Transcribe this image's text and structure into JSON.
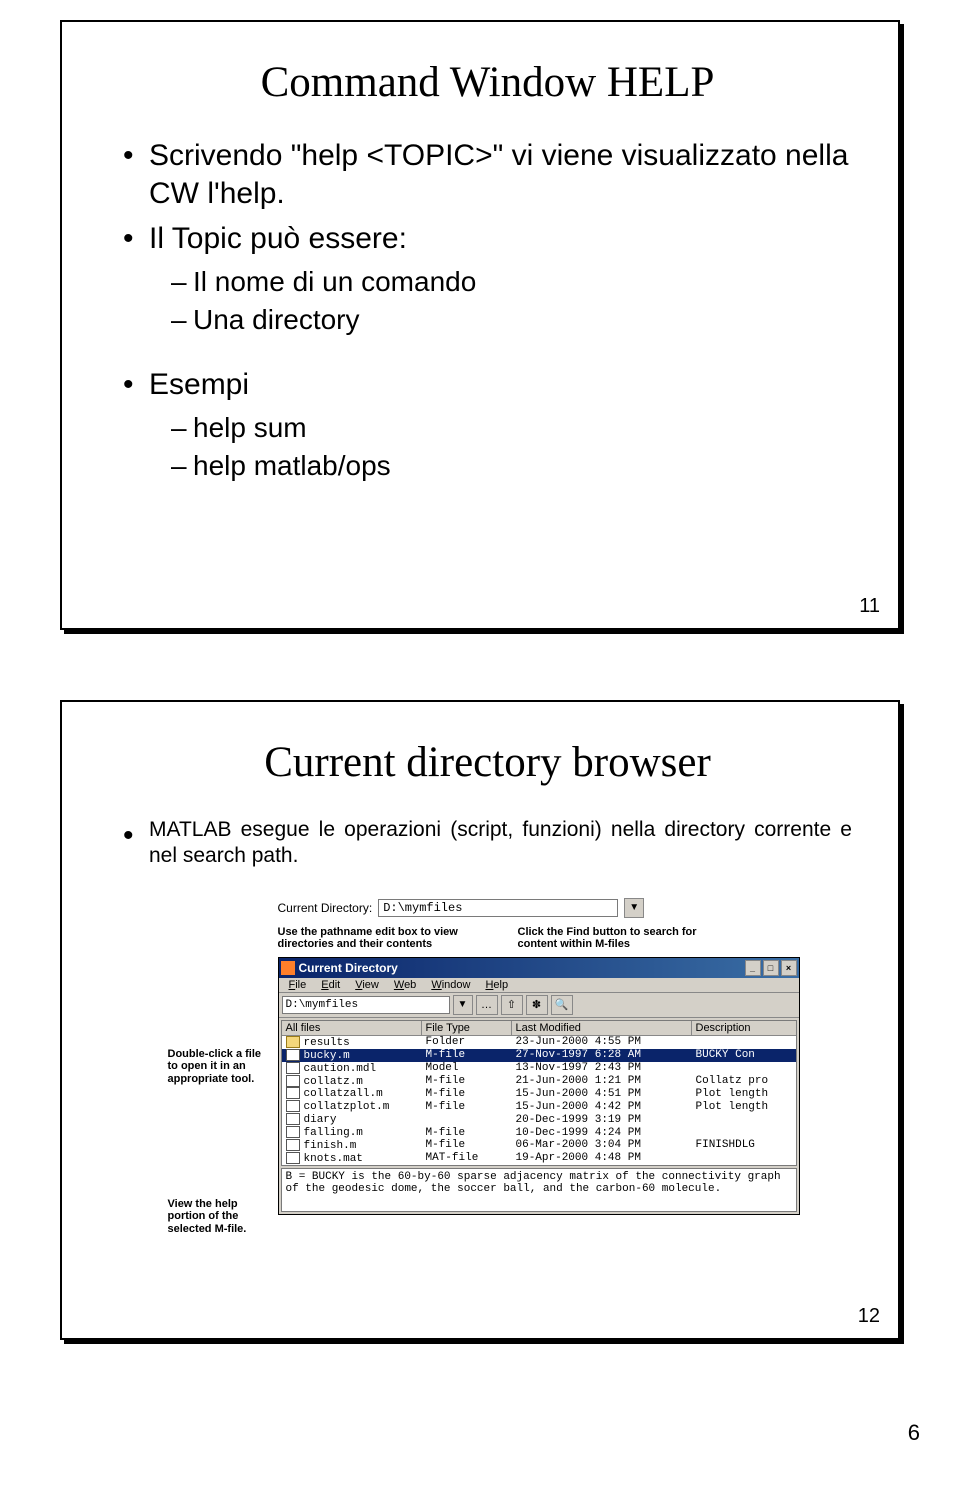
{
  "page_number": "6",
  "slide1": {
    "title": "Command Window HELP",
    "bullet1": "Scrivendo \"help <TOPIC>\" vi viene visualizzato nella CW l'help.",
    "bullet2": "Il Topic può essere:",
    "sub2a": "Il nome di un comando",
    "sub2b": "Una directory",
    "bullet3": "Esempi",
    "sub3a": "help sum",
    "sub3b": "help matlab/ops",
    "num": "11"
  },
  "slide2": {
    "title": "Current directory browser",
    "body": "MATLAB esegue le operazioni (script, funzioni) nella directory corrente e nel search path.",
    "num": "12",
    "cd_label": "Current Directory:",
    "cd_value": "D:\\mymfiles",
    "callout_left_top": "Use the pathname edit box to view directories and their contents",
    "callout_right_top": "Click the Find button to search for content within M-files",
    "callout_side1": "Double-click a file to open it in an appropriate tool.",
    "callout_side2": "View the help portion of the selected M-file.",
    "win_title": "Current Directory",
    "menus": [
      "File",
      "Edit",
      "View",
      "Web",
      "Window",
      "Help"
    ],
    "toolbar_path": "D:\\mymfiles",
    "headers": [
      "All files",
      "File Type",
      "Last Modified",
      "Description"
    ],
    "rows": [
      {
        "name": "results",
        "type": "Folder",
        "mod": "23-Jun-2000  4:55 PM",
        "desc": ""
      },
      {
        "name": "bucky.m",
        "type": "M-file",
        "mod": "27-Nov-1997  6:28 AM",
        "desc": "BUCKY  Con",
        "sel": true
      },
      {
        "name": "caution.mdl",
        "type": "Model",
        "mod": "13-Nov-1997  2:43 PM",
        "desc": ""
      },
      {
        "name": "collatz.m",
        "type": "M-file",
        "mod": "21-Jun-2000  1:21 PM",
        "desc": "Collatz pro"
      },
      {
        "name": "collatzall.m",
        "type": "M-file",
        "mod": "15-Jun-2000  4:51 PM",
        "desc": "Plot length"
      },
      {
        "name": "collatzplot.m",
        "type": "M-file",
        "mod": "15-Jun-2000  4:42 PM",
        "desc": "Plot length"
      },
      {
        "name": "diary",
        "type": "",
        "mod": "20-Dec-1999  3:19 PM",
        "desc": ""
      },
      {
        "name": "falling.m",
        "type": "M-file",
        "mod": "10-Dec-1999  4:24 PM",
        "desc": ""
      },
      {
        "name": "finish.m",
        "type": "M-file",
        "mod": "06-Mar-2000  3:04 PM",
        "desc": "FINISHDLG"
      },
      {
        "name": "knots.mat",
        "type": "MAT-file",
        "mod": "19-Apr-2000  4:48 PM",
        "desc": ""
      }
    ],
    "help_text": "B = BUCKY is the 60-by-60 sparse adjacency matrix of the connectivity graph of the geodesic dome, the soccer ball, and the carbon-60 molecule."
  }
}
